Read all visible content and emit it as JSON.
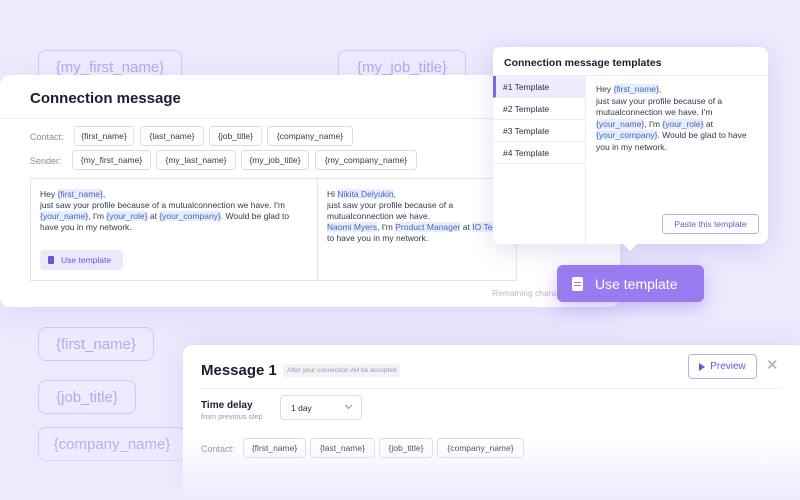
{
  "background_chips": [
    "{my_first_name}",
    "{my_job_title}",
    "{first_name}",
    "{job_title}",
    "{company_name}"
  ],
  "connection": {
    "title": "Connection message",
    "contact_label": "Contact:",
    "contact_vars": [
      "{first_name}",
      "{last_name}",
      "{job_title}",
      "{company_name}"
    ],
    "sender_label": "Sender:",
    "sender_vars": [
      "{my_first_name}",
      "{my_last_name}",
      "{my_job_title}",
      "{my_company_name}"
    ],
    "editor_left": {
      "greeting": "Hey",
      "v_first_name": "{first_name}",
      "comma": ",",
      "line2": "just saw your profile because of a mutualconnection we have. I'm",
      "v_your_name": "{your_name}",
      "sep1": ", I'm",
      "v_your_role": "{your_role}",
      "at": " at",
      "v_your_company": "{your_company}",
      "tail": ". Would be glad to have you in my network."
    },
    "editor_right": {
      "greeting": "Hi",
      "name": "Nikita Delyukin",
      "comma": ",",
      "line2": "just saw your profile because of a mutualconnection we have.",
      "line3_name": "Naomi Myers",
      "sep1": ", I'm",
      "role": "Product Manager",
      "at": " at",
      "company": "IO Tec",
      "tail": "to have you in my network."
    },
    "use_template_small": "Use template",
    "remaining": "Remaining chara"
  },
  "templates_popup": {
    "title": "Connection message templates",
    "items": [
      "#1 Template",
      "#2 Template",
      "#3 Template",
      "#4 Template"
    ],
    "preview": {
      "greeting": "Hey",
      "v_first_name": "{first_name}",
      "comma": ",",
      "line2": "just saw your profile because of a mutualconnection we have. I'm",
      "v_your_name": "{your_name}",
      "sep1": ", I'm",
      "v_your_role": "{your_role}",
      "at": " at",
      "v_your_company": "{your_company}",
      "tail": ". Would be glad to have you in my network."
    },
    "paste_button": "Paste this template"
  },
  "use_template_big": "Use template",
  "message": {
    "title": "Message 1",
    "note": "After your connection will be accepted",
    "preview_button": "Preview",
    "close": "✕",
    "time_delay_label": "Time delay",
    "time_delay_sub": "from previous step",
    "delay_value": "1 day",
    "contact_label": "Contact:",
    "contact_vars": [
      "{first_name}",
      "{last_name}",
      "{job_title}",
      "{company_name}"
    ]
  }
}
